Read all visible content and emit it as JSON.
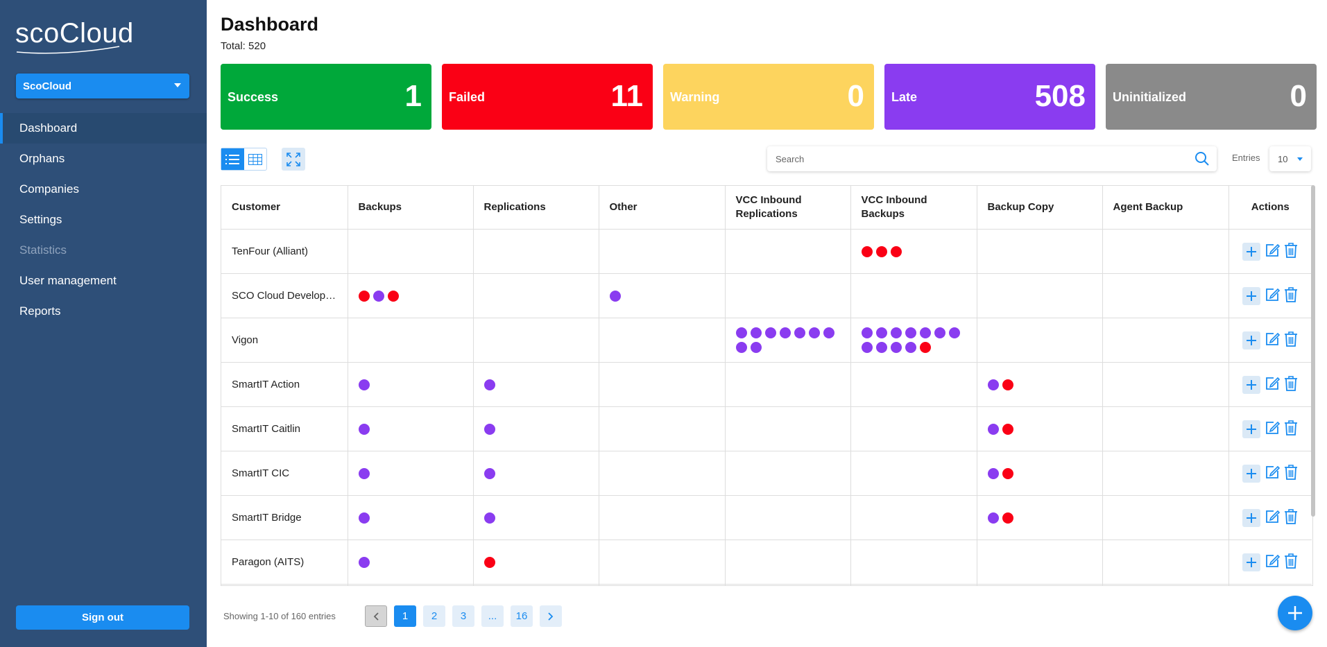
{
  "app": {
    "logo_text": "scoCloud",
    "tenant": "ScoCloud",
    "sign_out_label": "Sign out"
  },
  "nav": [
    {
      "label": "Dashboard",
      "active": true
    },
    {
      "label": "Orphans"
    },
    {
      "label": "Companies"
    },
    {
      "label": "Settings"
    },
    {
      "label": "Statistics",
      "disabled": true
    },
    {
      "label": "User management"
    },
    {
      "label": "Reports"
    }
  ],
  "page": {
    "title": "Dashboard",
    "total": "Total: 520"
  },
  "cards": [
    {
      "label": "Success",
      "value": "1",
      "color": "#00a83a"
    },
    {
      "label": "Failed",
      "value": "11",
      "color": "#fa0015"
    },
    {
      "label": "Warning",
      "value": "0",
      "color": "#fdd45e"
    },
    {
      "label": "Late",
      "value": "508",
      "color": "#8a3cf0"
    },
    {
      "label": "Uninitialized",
      "value": "0",
      "color": "#8a8a8a"
    }
  ],
  "search": {
    "placeholder": "Search"
  },
  "entries": {
    "label": "Entries",
    "value": "10"
  },
  "colors": {
    "late": "#8a3cf0",
    "failed": "#fa0015",
    "accent": "#1a8cf0",
    "sidebar": "#2e4f78"
  },
  "table": {
    "columns": [
      "Customer",
      "Backups",
      "Replications",
      "Other",
      "VCC Inbound Replications",
      "VCC Inbound Backups",
      "Backup Copy",
      "Agent Backup",
      "Actions"
    ],
    "rows": [
      {
        "customer": "TenFour (Alliant)",
        "backups": "",
        "replications": "",
        "other": "",
        "vcc_rep": "",
        "vcc_bak": "rrr",
        "copy": "",
        "agent": ""
      },
      {
        "customer": "SCO Cloud Develop…",
        "backups": "rpr",
        "replications": "",
        "other": "p",
        "vcc_rep": "",
        "vcc_bak": "",
        "copy": "",
        "agent": ""
      },
      {
        "customer": "Vigon",
        "backups": "",
        "replications": "",
        "other": "",
        "vcc_rep": "ppppppppp",
        "vcc_bak": "pppppppppppr",
        "copy": "",
        "agent": ""
      },
      {
        "customer": "SmartIT Action",
        "backups": "p",
        "replications": "p",
        "other": "",
        "vcc_rep": "",
        "vcc_bak": "",
        "copy": "pr",
        "agent": ""
      },
      {
        "customer": "SmartIT Caitlin",
        "backups": "p",
        "replications": "p",
        "other": "",
        "vcc_rep": "",
        "vcc_bak": "",
        "copy": "pr",
        "agent": ""
      },
      {
        "customer": "SmartIT CIC",
        "backups": "p",
        "replications": "p",
        "other": "",
        "vcc_rep": "",
        "vcc_bak": "",
        "copy": "pr",
        "agent": ""
      },
      {
        "customer": "SmartIT Bridge",
        "backups": "p",
        "replications": "p",
        "other": "",
        "vcc_rep": "",
        "vcc_bak": "",
        "copy": "pr",
        "agent": ""
      },
      {
        "customer": "Paragon (AITS)",
        "backups": "p",
        "replications": "r",
        "other": "",
        "vcc_rep": "",
        "vcc_bak": "",
        "copy": "",
        "agent": ""
      },
      {
        "customer": "",
        "backups": "",
        "replications": "",
        "other": "",
        "vcc_rep": "",
        "vcc_bak": "",
        "copy": "",
        "agent": ""
      }
    ]
  },
  "pagination": {
    "showing": "Showing 1-10 of 160 entries",
    "pages": [
      "1",
      "2",
      "3",
      "...",
      "16"
    ],
    "current": "1"
  }
}
